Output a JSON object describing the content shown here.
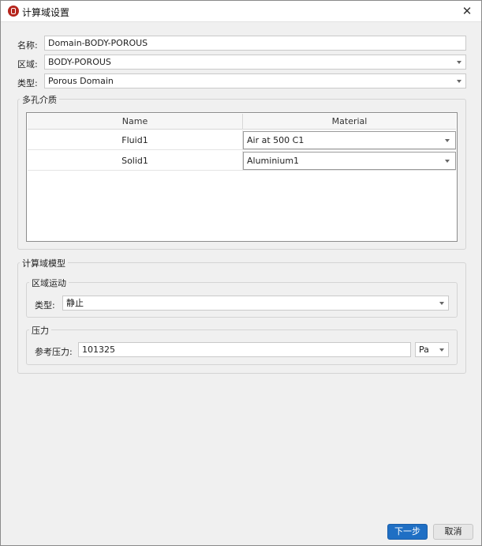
{
  "window": {
    "title": "计算域设置",
    "close_glyph": "✕"
  },
  "form": {
    "name_label": "名称:",
    "name_value": "Domain-BODY-POROUS",
    "region_label": "区域:",
    "region_value": "BODY-POROUS",
    "type_label": "类型:",
    "type_value": "Porous Domain"
  },
  "porous_media": {
    "group_title": "多孔介质",
    "columns": [
      "Name",
      "Material"
    ],
    "rows": [
      {
        "name": "Fluid1",
        "material": "Air at 500 C1"
      },
      {
        "name": "Solid1",
        "material": "Aluminium1"
      }
    ]
  },
  "domain_model": {
    "group_title": "计算域模型",
    "motion": {
      "group_title": "区域运动",
      "type_label": "类型:",
      "type_value": "静止"
    },
    "pressure": {
      "group_title": "压力",
      "ref_label": "参考压力:",
      "ref_value": "101325",
      "unit": "Pa"
    }
  },
  "buttons": {
    "next": "下一步",
    "cancel": "取消"
  },
  "colors": {
    "primary": "#1f6fc4",
    "app_icon": "#b5251d"
  },
  "icons": {
    "app": "app-logo-icon",
    "close": "close-icon",
    "dropdown": "chevron-down-icon"
  }
}
